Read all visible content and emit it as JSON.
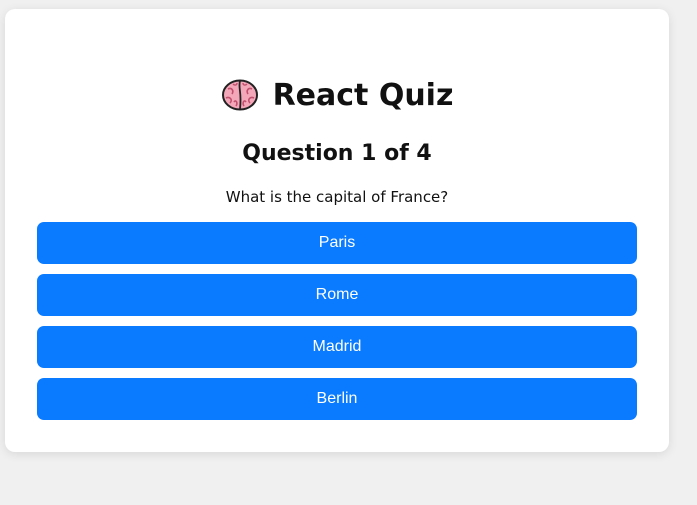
{
  "quiz": {
    "title": "React Quiz",
    "icon": "brain-icon",
    "question_heading": "Question 1 of 4",
    "question_text": "What is the capital of France?",
    "options": [
      {
        "label": "Paris"
      },
      {
        "label": "Rome"
      },
      {
        "label": "Madrid"
      },
      {
        "label": "Berlin"
      }
    ]
  },
  "colors": {
    "background": "#f0f0f0",
    "card": "#ffffff",
    "button": "#0a7bff",
    "button_text": "#ffffff",
    "text": "#111111"
  }
}
